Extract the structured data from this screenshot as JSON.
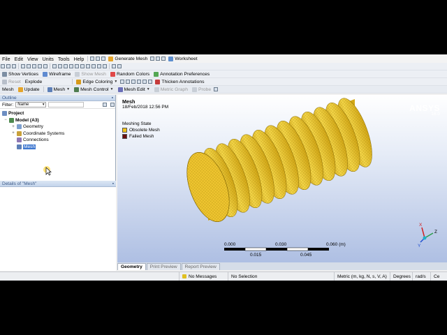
{
  "menu": [
    "File",
    "Edit",
    "View",
    "Units",
    "Tools",
    "Help"
  ],
  "toolbar1": {
    "generate_mesh": "Generate Mesh",
    "worksheet": "Worksheet"
  },
  "toolbar2": {
    "show_vertices": "Show Vertices",
    "wireframe": "Wireframe",
    "show_mesh": "Show Mesh",
    "random_colors": "Random Colors",
    "annotation_prefs": "Annotation Preferences"
  },
  "toolbar3": {
    "reset": "Reset",
    "explode": "Explode",
    "edge_coloring": "Edge Coloring",
    "thicken_annotations": "Thicken Annotations"
  },
  "toolbar4": {
    "mesh": "Mesh",
    "update": "Update",
    "mesh_menu": "Mesh",
    "mesh_control": "Mesh Control",
    "mesh_edit": "Mesh Edit",
    "metric_graph": "Metric Graph",
    "probe": "Probe"
  },
  "outline": {
    "title": "Outline",
    "filter_label": "Filter:",
    "filter_value": "Name",
    "tree": {
      "project": "Project",
      "model": "Model (A3)",
      "geometry": "Geometry",
      "coordinate_systems": "Coordinate Systems",
      "connections": "Connections",
      "mesh": "Mesh"
    }
  },
  "details": {
    "title": "Details of \"Mesh\""
  },
  "viewport": {
    "title": "Mesh",
    "date": "18/Feb/2018 12:56 PM",
    "brand": "ANSYS",
    "version": "16.0",
    "legend_title": "Meshing State",
    "legend": [
      {
        "label": "Obsolete Mesh",
        "color": "#f2c21b"
      },
      {
        "label": "Failed Mesh",
        "color": "#6b0f0f"
      }
    ],
    "scale_top": [
      "0.000",
      "0.030",
      "0.060 (m)"
    ],
    "scale_bottom": [
      "0.015",
      "0.045"
    ],
    "axes": {
      "x": "X",
      "y": "Y",
      "z": "Z"
    }
  },
  "tabs": [
    "Geometry",
    "Print Preview",
    "Report Preview"
  ],
  "status": {
    "messages": "No Messages",
    "selection": "No Selection",
    "units": "Metric (m, kg, N, s, V, A)",
    "angle": "Degrees",
    "rate": "rad/s",
    "temp": "Ce"
  },
  "colors": {
    "mesh": "#f0cc2a",
    "mesh_dark": "#8a6d06",
    "accent": "#3e77d0"
  }
}
